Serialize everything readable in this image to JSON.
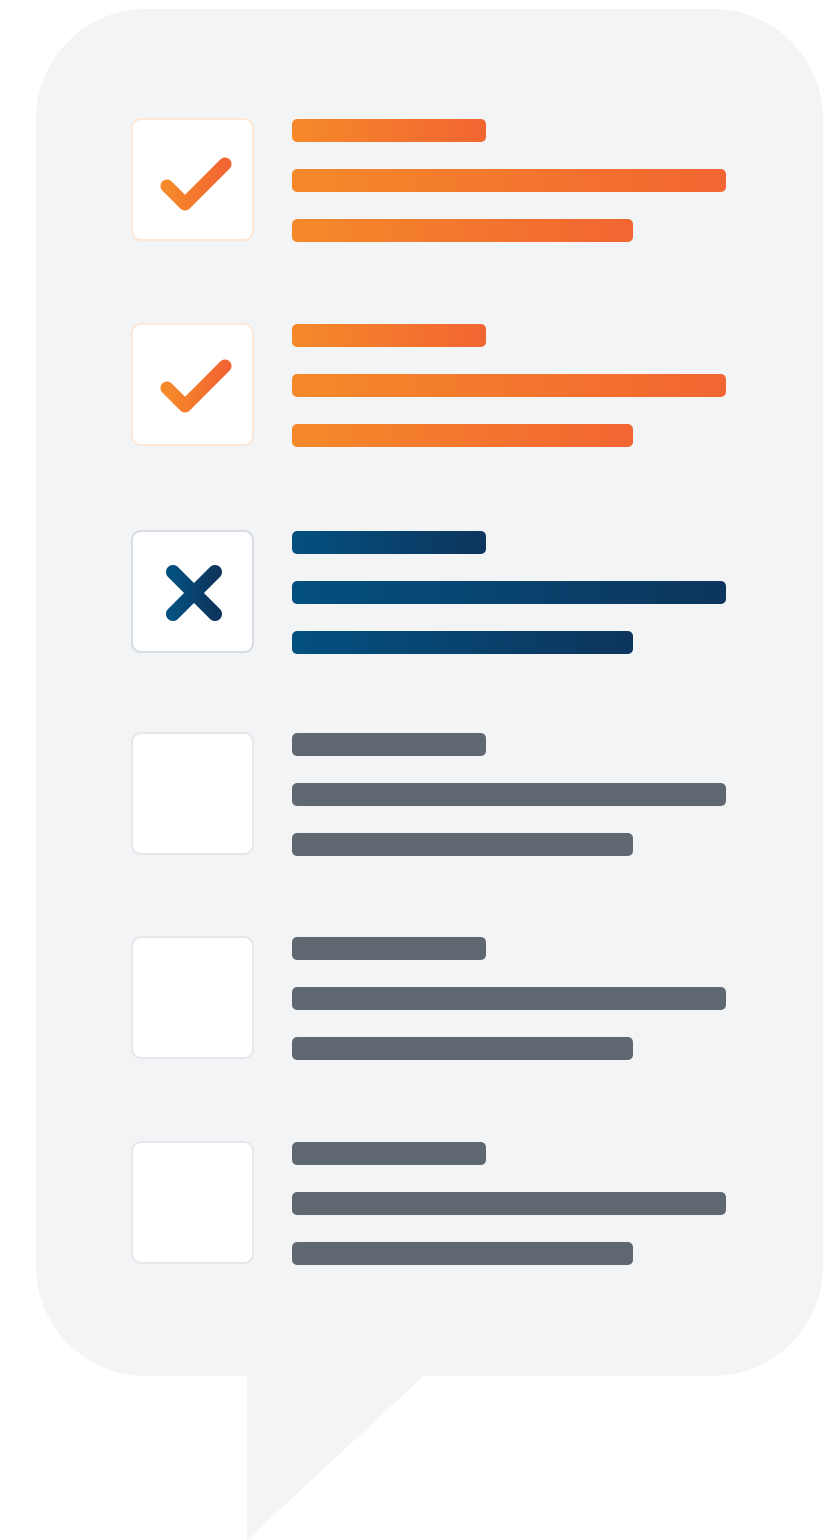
{
  "colors": {
    "bubble": "#f3f4f6",
    "checked_gradient": [
      "#f5892a",
      "#f26532"
    ],
    "checked_border": "#fde8d6",
    "rejected_gradient": [
      "#03507f",
      "#0d355d"
    ],
    "rejected_border": "#d7dde3",
    "pending_bar": "#5f6770",
    "pending_border": "#e3e5e8"
  },
  "checklist": {
    "items": [
      {
        "status": "checked",
        "icon": "checkmark-icon"
      },
      {
        "status": "checked",
        "icon": "checkmark-icon"
      },
      {
        "status": "rejected",
        "icon": "cross-icon"
      },
      {
        "status": "unchecked",
        "icon": ""
      },
      {
        "status": "unchecked",
        "icon": ""
      },
      {
        "status": "unchecked",
        "icon": ""
      }
    ]
  }
}
